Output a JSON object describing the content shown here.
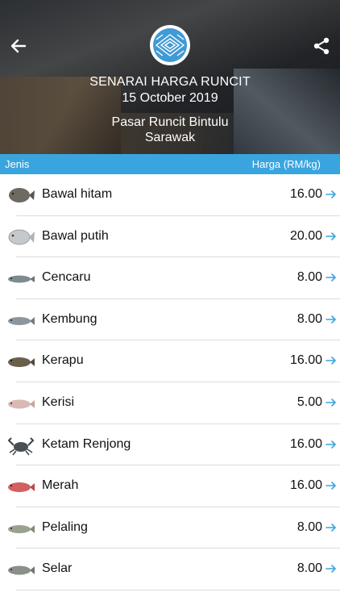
{
  "header": {
    "title": "SENARAI HARGA RUNCIT",
    "date": "15 October 2019",
    "market": "Pasar Runcit Bintulu",
    "state": "Sarawak"
  },
  "columns": {
    "left": "Jenis",
    "right": "Harga (RM/kg)"
  },
  "items": [
    {
      "name": "Bawal hitam",
      "price": "16.00",
      "icon": "pomfret-black-fish-icon"
    },
    {
      "name": "Bawal putih",
      "price": "20.00",
      "icon": "pomfret-white-fish-icon"
    },
    {
      "name": "Cencaru",
      "price": "8.00",
      "icon": "scad-fish-icon"
    },
    {
      "name": "Kembung",
      "price": "8.00",
      "icon": "mackerel-fish-icon"
    },
    {
      "name": "Kerapu",
      "price": "16.00",
      "icon": "grouper-fish-icon"
    },
    {
      "name": "Kerisi",
      "price": "5.00",
      "icon": "threadfin-bream-fish-icon"
    },
    {
      "name": "Ketam Renjong",
      "price": "16.00",
      "icon": "crab-icon"
    },
    {
      "name": "Merah",
      "price": "16.00",
      "icon": "red-snapper-fish-icon"
    },
    {
      "name": "Pelaling",
      "price": "8.00",
      "icon": "mackerel-fish-icon"
    },
    {
      "name": "Selar",
      "price": "8.00",
      "icon": "trevally-fish-icon"
    }
  ],
  "colors": {
    "accent": "#3aa4df",
    "arrow": "#3aa4df",
    "separator": "#dcdcdc"
  }
}
